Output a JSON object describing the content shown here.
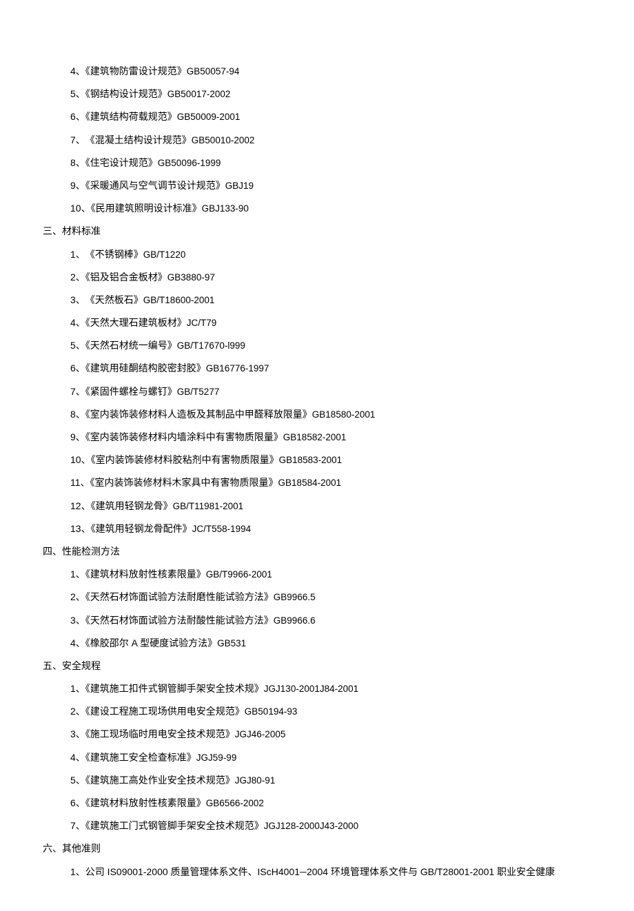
{
  "sections": [
    {
      "heading": null,
      "items": [
        {
          "num": "4、",
          "title": "《建筑物防雷设计规范》",
          "code": "GB50057-94"
        },
        {
          "num": "5、",
          "title": "《钢结构设计规范》",
          "code": "GB50017-2002"
        },
        {
          "num": "6、",
          "title": "《建筑结构荷载规范》",
          "code": "GB50009-2001"
        },
        {
          "num": "7、",
          "title": "　《混凝土结构设计规范》",
          "code": "GB50010-2002"
        },
        {
          "num": "8、",
          "title": "《住宅设计规范》",
          "code": "GB50096-1999"
        },
        {
          "num": "9、",
          "title": "《采暖通风与空气调节设计规范》",
          "code": "GBJ19"
        },
        {
          "num": "10、",
          "title": "《民用建筑照明设计标准》",
          "code": "GBJ133-90"
        }
      ]
    },
    {
      "heading": "三、材料标准",
      "items": [
        {
          "num": "1、",
          "title": "　《不锈钢棒》",
          "code": "GB/T1220"
        },
        {
          "num": "2、",
          "title": "《铝及铝合金板材》",
          "code": "GB3880-97"
        },
        {
          "num": "3、",
          "title": "　《天然板石》",
          "code": "GB/T18600-2001"
        },
        {
          "num": "4、",
          "title": "《天然大理石建筑板材》",
          "code": "JC/T79"
        },
        {
          "num": "5、",
          "title": "《天然石材统一编号》",
          "code": "GB/T17670-l999"
        },
        {
          "num": "6、",
          "title": "《建筑用硅酮结构胶密封胶》",
          "code": "GB16776-1997"
        },
        {
          "num": "7、",
          "title": "《紧固件螺栓与螺钉》",
          "code": "GB/T5277"
        },
        {
          "num": "8、",
          "title": "《室内装饰装修材料人造板及其制品中甲醛释放限量》",
          "code": "GB18580-2001"
        },
        {
          "num": "9、",
          "title": "《室内装饰装修材料内墙涂料中有害物质限量》",
          "code": "GB18582-2001"
        },
        {
          "num": "10、",
          "title": "《室内装饰装修材料胶粘剂中有害物质限量》",
          "code": "GB18583-2001"
        },
        {
          "num": "11、",
          "title": "《室内装饰装修材料木家具中有害物质限量》",
          "code": "GB18584-2001"
        },
        {
          "num": "12、",
          "title": "《建筑用轻钢龙骨》",
          "code": "GB/T11981-2001"
        },
        {
          "num": "13、",
          "title": "《建筑用轻钢龙骨配件》",
          "code": "JC/T558-1994"
        }
      ]
    },
    {
      "heading": "四、性能检测方法",
      "items": [
        {
          "num": "1、",
          "title": "《建筑材料放射性核素限量》",
          "code": "GB/T9966-2001"
        },
        {
          "num": "2、",
          "title": "《天然石材饰面试验方法耐磨性能试验方法》",
          "code": "GB9966.5"
        },
        {
          "num": "3、",
          "title": "《天然石材饰面试验方法耐酸性能试验方法》",
          "code": "GB9966.6"
        },
        {
          "num": "4、",
          "title": "《橡胶邵尔 A 型硬度试验方法》",
          "code": "GB531"
        }
      ]
    },
    {
      "heading": "五、安全规程",
      "items": [
        {
          "num": "1、",
          "title": "《建筑施工扣件式钢管脚手架安全技术规》",
          "code": "JGJ130-2001J84-2001"
        },
        {
          "num": "2、",
          "title": "《建设工程施工现场供用电安全规范》",
          "code": "GB50194-93"
        },
        {
          "num": "3、",
          "title": "《施工现场临时用电安全技术规范》",
          "code": "JGJ46-2005"
        },
        {
          "num": "4、",
          "title": "《建筑施工安全检查标准》",
          "code": "JGJ59-99"
        },
        {
          "num": "5、",
          "title": "《建筑施工高处作业安全技术规范》",
          "code": "JGJ80-91"
        },
        {
          "num": "6、",
          "title": "《建筑材料放射性核素限量》",
          "code": "GB6566-2002"
        },
        {
          "num": "7、",
          "title": "《建筑施工门式钢管脚手架安全技术规范》",
          "code": "JGJ128-2000J43-2000"
        }
      ]
    },
    {
      "heading": "六、其他准则",
      "items": [
        {
          "num": "1、",
          "title": "公司 IS09001-2000 质量管理体系文件、IScH4001─2004 环境管理体系文件与 GB/T28001-2001 职业安全健康",
          "code": ""
        }
      ]
    }
  ]
}
